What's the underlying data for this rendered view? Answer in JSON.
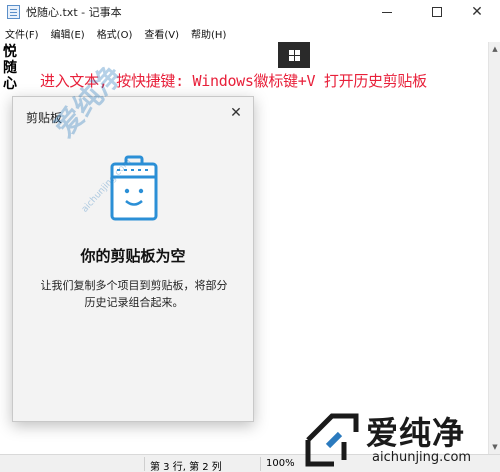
{
  "window": {
    "title": "悦随心.txt - 记事本",
    "minimize_glyph": "—",
    "close_glyph": "✕"
  },
  "menu": [
    {
      "label": "文件(F)"
    },
    {
      "label": "编辑(E)"
    },
    {
      "label": "格式(O)"
    },
    {
      "label": "查看(V)"
    },
    {
      "label": "帮助(H)"
    }
  ],
  "editor": {
    "lines": [
      "悦",
      "随",
      "心"
    ]
  },
  "annotation": {
    "text": "进入文本, 按快捷键: Windows徽标键+V 打开历史剪贴板",
    "color": "#e8203a"
  },
  "status": {
    "position": "第 3 行, 第 2 列",
    "zoom": "100%"
  },
  "clipboard": {
    "title": "剪贴板",
    "close_glyph": "✕",
    "empty_heading": "你的剪贴板为空",
    "empty_desc_line1": "让我们复制多个项目到剪贴板，将部分",
    "empty_desc_line2": "历史记录组合起来。",
    "illustration_color": "#2b8fd6"
  },
  "watermark": {
    "brand": "爱纯净",
    "url": "aichunjing.com",
    "color": "#2b7abe"
  }
}
